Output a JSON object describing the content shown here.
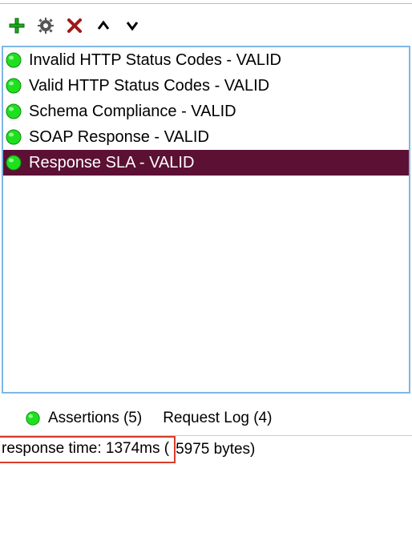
{
  "toolbar": {
    "add": "add",
    "config": "configure",
    "remove": "remove",
    "up": "move-up",
    "down": "move-down"
  },
  "assertions": [
    {
      "label": "Invalid HTTP Status Codes - VALID",
      "status": "valid",
      "selected": false
    },
    {
      "label": "Valid HTTP Status Codes - VALID",
      "status": "valid",
      "selected": false
    },
    {
      "label": "Schema Compliance - VALID",
      "status": "valid",
      "selected": false
    },
    {
      "label": "SOAP Response - VALID",
      "status": "valid",
      "selected": false
    },
    {
      "label": "Response SLA - VALID",
      "status": "valid",
      "selected": true
    }
  ],
  "tabs": {
    "assertions_label": "Assertions (5)",
    "request_log_label": "Request Log (4)"
  },
  "status": {
    "response_time_label": "response time: 1374ms (",
    "bytes_label": "5975 bytes)"
  },
  "colors": {
    "valid": "#1fe01f",
    "selected_bg": "#5c1034",
    "panel_border": "#7fb6e6",
    "highlight": "#d93b2b"
  }
}
